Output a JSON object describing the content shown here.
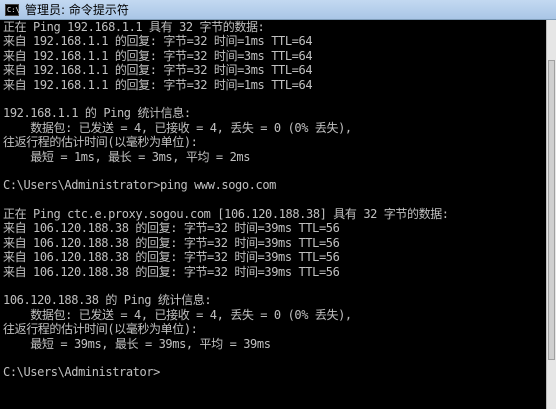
{
  "window": {
    "title": "管理员: 命令提示符",
    "icon": "cmd-icon",
    "icon_label": "C:\\"
  },
  "console": {
    "lines": [
      "正在 Ping 192.168.1.1 具有 32 字节的数据:",
      "来自 192.168.1.1 的回复: 字节=32 时间=1ms TTL=64",
      "来自 192.168.1.1 的回复: 字节=32 时间=3ms TTL=64",
      "来自 192.168.1.1 的回复: 字节=32 时间=3ms TTL=64",
      "来自 192.168.1.1 的回复: 字节=32 时间=1ms TTL=64",
      "",
      "192.168.1.1 的 Ping 统计信息:",
      "    数据包: 已发送 = 4, 已接收 = 4, 丢失 = 0 (0% 丢失),",
      "往返行程的估计时间(以毫秒为单位):",
      "    最短 = 1ms, 最长 = 3ms, 平均 = 2ms",
      "",
      "C:\\Users\\Administrator>ping www.sogo.com",
      "",
      "正在 Ping ctc.e.proxy.sogou.com [106.120.188.38] 具有 32 字节的数据:",
      "来自 106.120.188.38 的回复: 字节=32 时间=39ms TTL=56",
      "来自 106.120.188.38 的回复: 字节=32 时间=39ms TTL=56",
      "来自 106.120.188.38 的回复: 字节=32 时间=39ms TTL=56",
      "来自 106.120.188.38 的回复: 字节=32 时间=39ms TTL=56",
      "",
      "106.120.188.38 的 Ping 统计信息:",
      "    数据包: 已发送 = 4, 已接收 = 4, 丢失 = 0 (0% 丢失),",
      "往返行程的估计时间(以毫秒为单位):",
      "    最短 = 39ms, 最长 = 39ms, 平均 = 39ms",
      "",
      "C:\\Users\\Administrator>"
    ]
  }
}
